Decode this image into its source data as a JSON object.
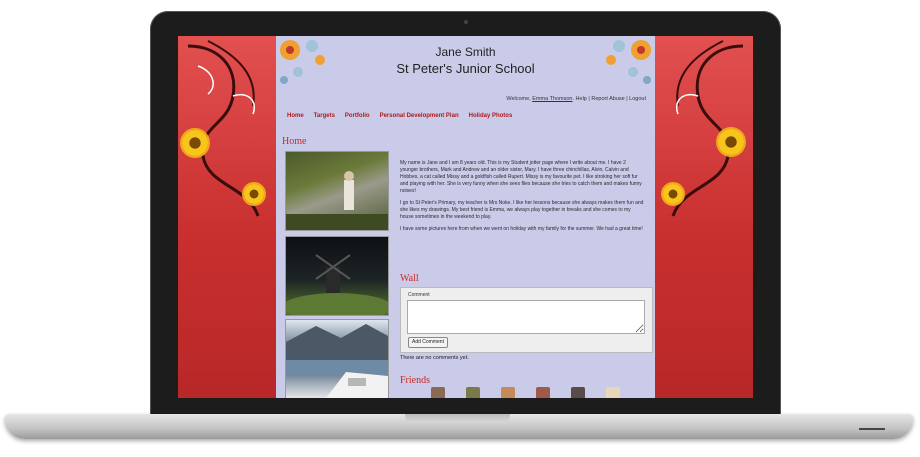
{
  "header": {
    "student_name": "Jane Smith",
    "school_name": "St Peter's Junior School"
  },
  "top_links": {
    "welcome_prefix": "Welcome,",
    "user": "Emma Thomson",
    "rest": ". Help | Report Abuse | Logout"
  },
  "nav": {
    "items": [
      {
        "label": "Home"
      },
      {
        "label": "Targets"
      },
      {
        "label": "Portfolio"
      },
      {
        "label": "Personal Development Plan"
      },
      {
        "label": "Holiday Photos"
      }
    ]
  },
  "home": {
    "heading": "Home",
    "paragraphs": [
      "My name is Jane and I am 8 years old. This is my Student jotter page where I write about me. I have 2 younger brothers, Mark and Andrew and an older sister, Mary. I have three chinchillas, Alvin, Calvin and Hobbes, a cat called Missy and a goldfish called Rupert. Missy is my favourite pet. I like stroking her soft fur and playing with her. She is very funny when she sees flies because she tries to catch them and makes funny noises!",
      "I go to St Peter's Primary, my teacher is Mrs Noke. I like her lessons because she always makes them fun and she likes my drawings. My best friend is Emma, we always play together in breaks and she comes to my house sometimes in the weekend to play.",
      "I have some pictures here from when we went on holiday with my family for the summer. We had a great time!"
    ]
  },
  "wall": {
    "heading": "Wall",
    "comment_label": "Comment",
    "comment_value": "",
    "add_button": "Add Comment",
    "no_comments": "There are no comments yet."
  },
  "friends": {
    "heading": "Friends"
  },
  "colors": {
    "background_red": "#d23a3a",
    "page_lavender": "#c9cbe9",
    "heading_red": "#c62b2b",
    "nav_red": "#b01a1a"
  },
  "icons": [
    "flower-decoration-icon",
    "swirl-decoration-icon"
  ]
}
